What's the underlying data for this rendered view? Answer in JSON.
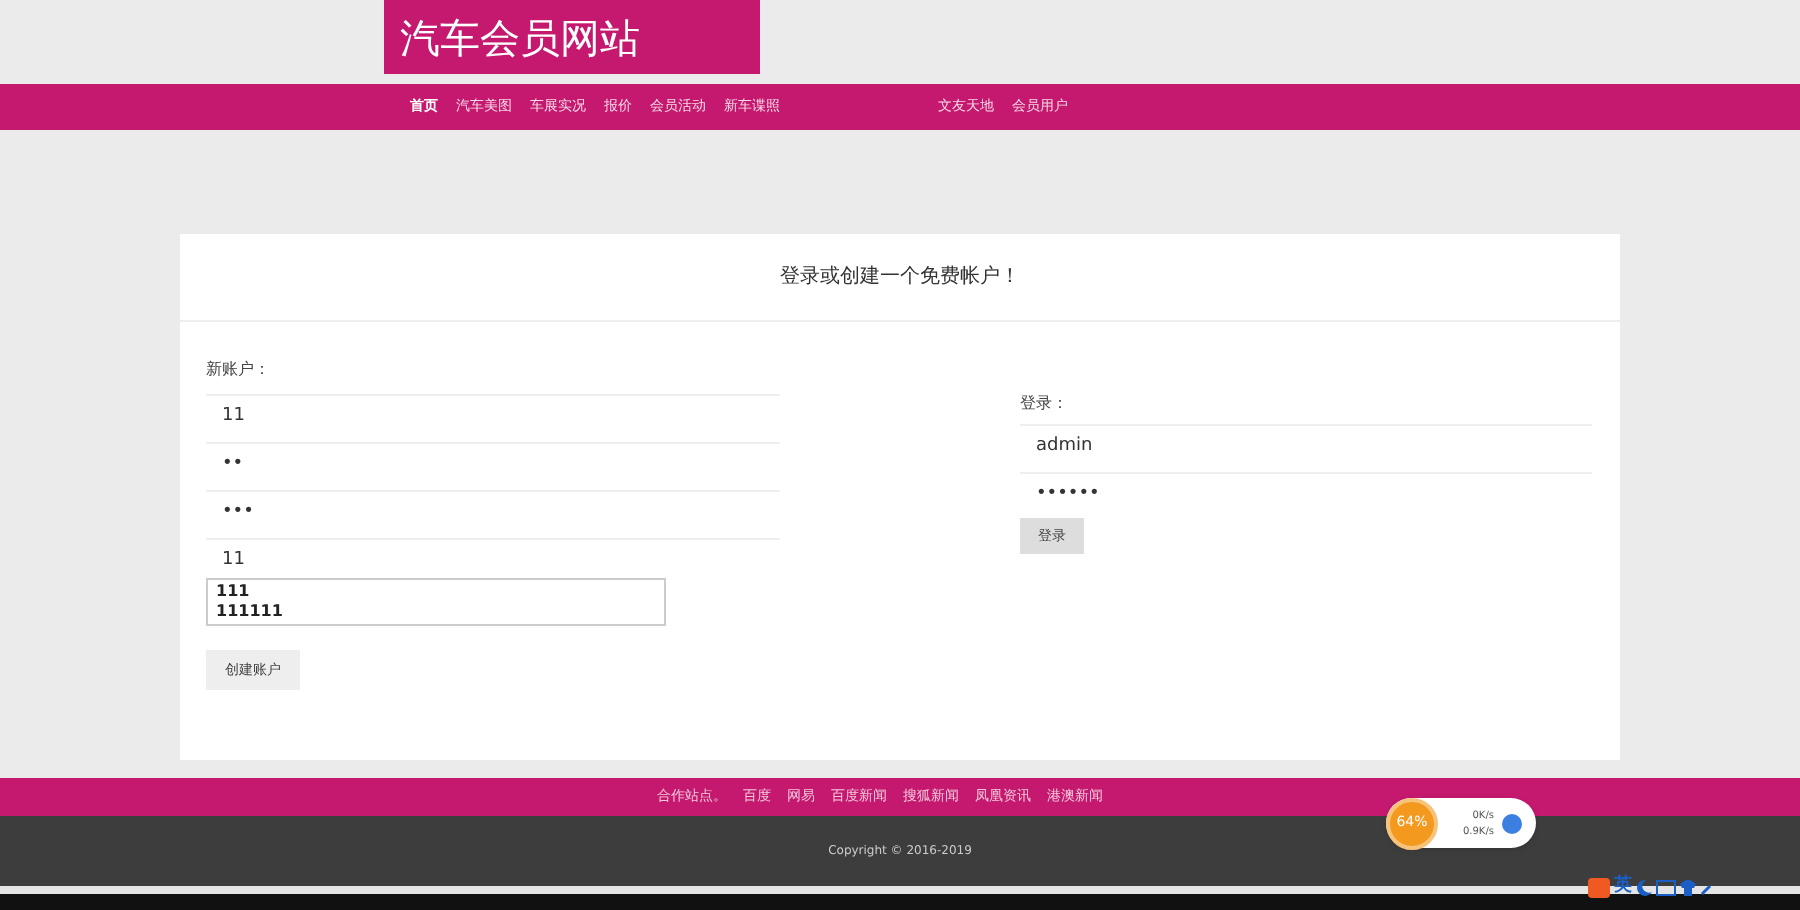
{
  "site_title": "汽车会员网站",
  "nav": [
    {
      "label": "首页",
      "selected": true
    },
    {
      "label": "汽车美图",
      "selected": false
    },
    {
      "label": "车展实况",
      "selected": false
    },
    {
      "label": "报价",
      "selected": false
    },
    {
      "label": "会员活动",
      "selected": false
    },
    {
      "label": "新车谍照",
      "selected": false
    },
    {
      "label": "文友天地",
      "selected": false
    },
    {
      "label": "会员用户",
      "selected": false
    }
  ],
  "card_title": "登录或创建一个免费帐户！",
  "register": {
    "label": "新账户：",
    "fields": [
      {
        "value": "11"
      },
      {
        "value": "••"
      },
      {
        "value": "•••"
      },
      {
        "value": "11"
      }
    ],
    "suggestions": [
      "111",
      "111111"
    ],
    "button": "创建账户"
  },
  "login": {
    "label": "登录：",
    "fields": [
      {
        "value": "admin"
      },
      {
        "value": "••••••"
      }
    ],
    "button": "登录"
  },
  "footer": {
    "links": [
      "合作站点。",
      "百度",
      "网易",
      "百度新闻",
      "搜狐新闻",
      "凤凰资讯",
      "港澳新闻"
    ],
    "copyright": "Copyright © 2016-2019"
  },
  "net_widget": {
    "percent": "64%",
    "up": "0K/s",
    "down": "0.9K/s"
  },
  "ime": {
    "mode": "英"
  }
}
